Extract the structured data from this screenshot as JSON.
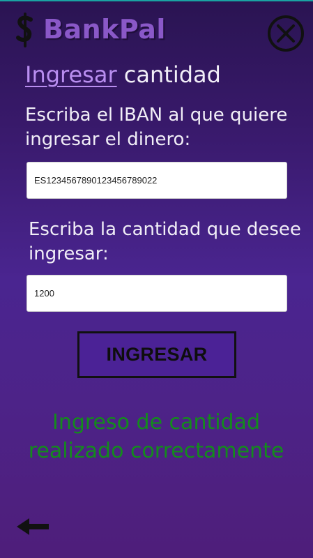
{
  "app": {
    "name": "BankPal"
  },
  "header": {
    "logo_icon": "bank-dollar-icon",
    "close_icon": "close-circle-icon"
  },
  "page": {
    "title_highlight": "Ingresar",
    "title_rest": " cantidad"
  },
  "form": {
    "iban_label": "Escriba el IBAN al que quiere ingresar el dinero:",
    "iban_value": "ES12345678901234567890​22",
    "amount_label": "Escriba la cantidad que desee ingresar:",
    "amount_value": "1200",
    "submit_label": "INGRESAR"
  },
  "status": {
    "message": "Ingreso de cantidad realizado correctamente",
    "color": "#138c1c"
  },
  "footer": {
    "back_icon": "arrow-left-icon"
  },
  "colors": {
    "accent": "#b98ef0",
    "brand": "#8a58c8",
    "button_bg": "#4b2296"
  }
}
